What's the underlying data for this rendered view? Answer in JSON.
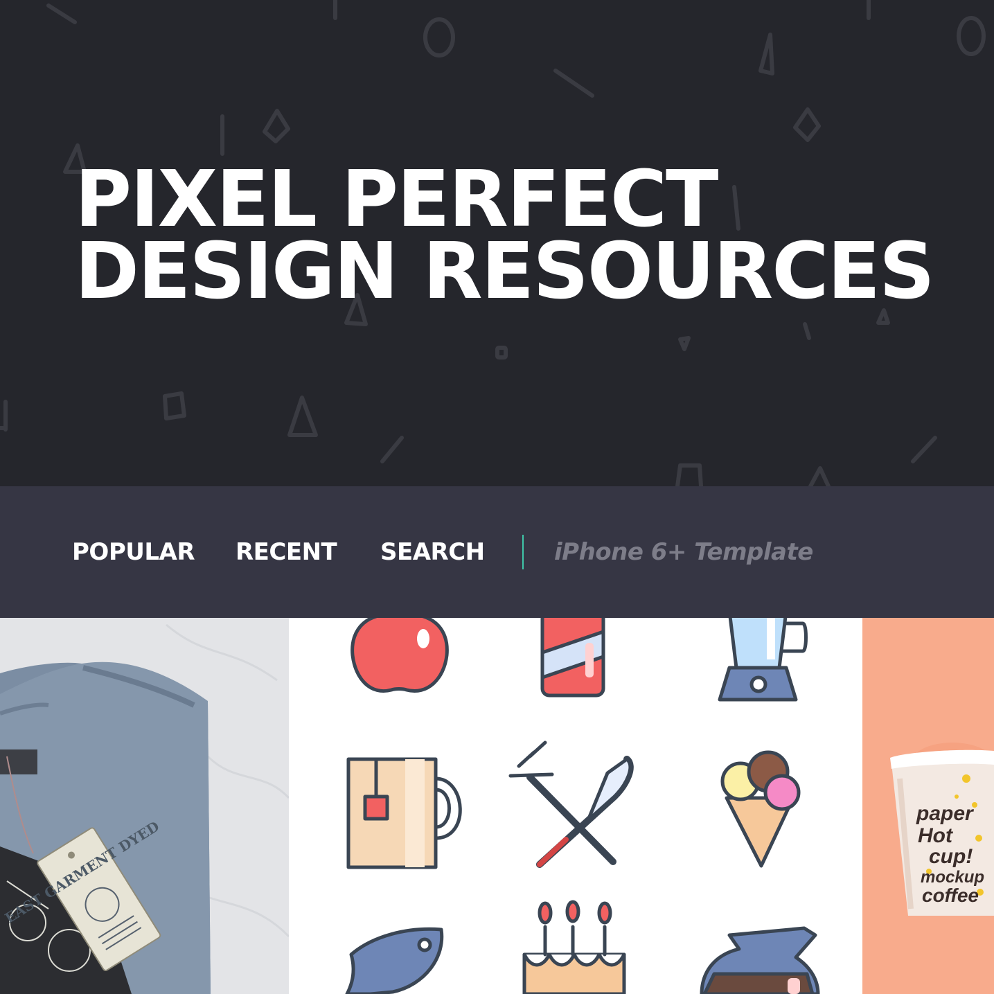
{
  "hero": {
    "title_line1": "PIXEL PERFECT",
    "title_line2": "DESIGN RESOURCES"
  },
  "nav": {
    "links": [
      {
        "label": "POPULAR"
      },
      {
        "label": "RECENT"
      },
      {
        "label": "SEARCH"
      }
    ],
    "search": {
      "placeholder": "iPhone 6+ Template"
    }
  },
  "gallery": {
    "items": [
      {
        "subject": "folded-tshirt-mockup",
        "tag_text": "EAST GARMENT DYED"
      },
      {
        "subject": "food-icon-set"
      },
      {
        "subject": "paper-cup-mockup",
        "cup_text": [
          "paper",
          "Hot",
          "cup!",
          "mockup",
          "coffee"
        ]
      }
    ]
  },
  "colors": {
    "hero_bg": "#25262c",
    "nav_bg": "#363644",
    "accent": "#3fc6a8",
    "search_text": "#7d7d89",
    "cup_bg": "#f8ab8c"
  }
}
